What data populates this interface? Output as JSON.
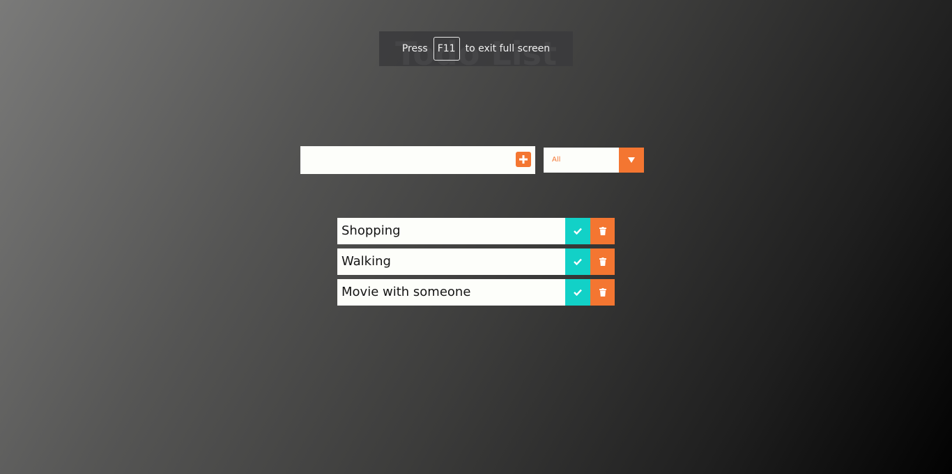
{
  "app": {
    "title": "Todo List"
  },
  "fullscreen_notice": {
    "prefix": "Press",
    "key": "F11",
    "suffix": "to exit full screen"
  },
  "form": {
    "input_value": "",
    "add_icon": "plus-square-icon",
    "filter": {
      "selected": "All"
    }
  },
  "todos": [
    {
      "text": "Shopping"
    },
    {
      "text": "Walking"
    },
    {
      "text": "Movie with someone"
    }
  ],
  "colors": {
    "accent": "#f47631",
    "complete": "#12d1c7",
    "surface": "#fdfefa"
  }
}
